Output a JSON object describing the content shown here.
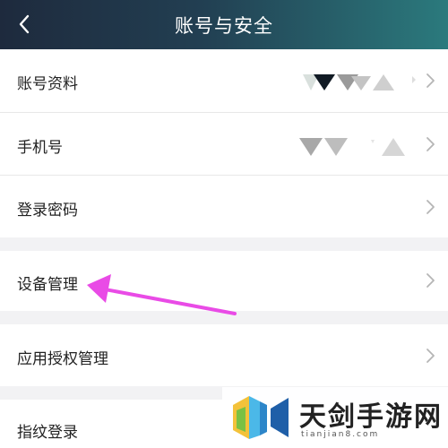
{
  "header": {
    "title": "账号与安全",
    "back_icon": "chevron-left-icon"
  },
  "settings": {
    "rows": [
      {
        "label": "账号资料",
        "value_masked": true
      },
      {
        "label": "手机号",
        "value_masked": true
      },
      {
        "label": "登录密码"
      },
      {
        "label": "设备管理",
        "highlighted_by_arrow": true
      },
      {
        "label": "应用授权管理"
      },
      {
        "label": "指纹登录"
      }
    ]
  },
  "colors": {
    "header_gradient_start": "#1e2a3d",
    "header_gradient_end": "#2b7a7d",
    "annotation_arrow": "#e94be6",
    "page_background": "#f2f2f4"
  },
  "watermark": {
    "text": "天剑手游网",
    "url": "tianjian8.com"
  }
}
